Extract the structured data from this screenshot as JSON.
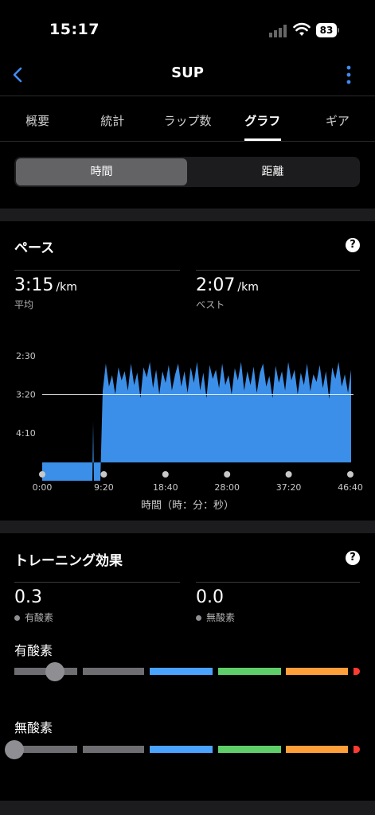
{
  "status": {
    "time": "15:17",
    "battery": "83"
  },
  "nav": {
    "title": "SUP"
  },
  "tabs": [
    {
      "label": "概要",
      "active": false
    },
    {
      "label": "統計",
      "active": false
    },
    {
      "label": "ラップ数",
      "active": false
    },
    {
      "label": "グラフ",
      "active": true
    },
    {
      "label": "ギア",
      "active": false
    }
  ],
  "segment": {
    "time": "時間",
    "distance": "距離",
    "selected": "time"
  },
  "pace": {
    "title": "ペース",
    "avg_value": "3:15",
    "avg_unit": "/km",
    "avg_label": "平均",
    "best_value": "2:07",
    "best_unit": "/km",
    "best_label": "ベスト"
  },
  "chart_data": {
    "type": "area",
    "xlabel": "時間（時：分：秒）",
    "x_ticks": [
      "0:00",
      "9:20",
      "18:40",
      "28:00",
      "37:20",
      "46:40"
    ],
    "y_ticks": [
      "2:30",
      "3:20",
      "4:10"
    ],
    "y_inverted": true,
    "avg_line": "3:20",
    "color": "#3b8fe8",
    "series": [
      {
        "values_sec_per_km": [
          312,
          312,
          312,
          312,
          312,
          312,
          312,
          312,
          312,
          312,
          312,
          312,
          312,
          312,
          312,
          312,
          312,
          312,
          312,
          312
        ]
      },
      {
        "note_values": "pace samples (sec/km) from ~9:20 to 46:40",
        "values": [
          195,
          160,
          190,
          175,
          200,
          165,
          182,
          170,
          195,
          160,
          188,
          172,
          205,
          165,
          178,
          158,
          192,
          168,
          200,
          170,
          185,
          162,
          195,
          175,
          160,
          190,
          170,
          198,
          165,
          185,
          158,
          195,
          172,
          205,
          162,
          180,
          168,
          192,
          160,
          188,
          175,
          200,
          166,
          182,
          158,
          195,
          170,
          188,
          164,
          198,
          172,
          160,
          190,
          176,
          205,
          163,
          185,
          170,
          195,
          158,
          182,
          168,
          200,
          172,
          188,
          160,
          196,
          174,
          184,
          162,
          192,
          170,
          206,
          165,
          180,
          158,
          190,
          174,
          198,
          168
        ]
      }
    ]
  },
  "training": {
    "title": "トレーニング効果",
    "aerobic_value": "0.3",
    "aerobic_label": "有酸素",
    "anaerobic_value": "0.0",
    "anaerobic_label": "無酸素",
    "aerobic_bar_label": "有酸素",
    "anaerobic_bar_label": "無酸素",
    "aerobic_level": 0.3,
    "anaerobic_level": 0.0,
    "segment_colors": [
      "#6e6e72",
      "#6e6e72",
      "#4aa3ff",
      "#5fce6a",
      "#ff9f3a",
      "#ff3b30"
    ]
  }
}
